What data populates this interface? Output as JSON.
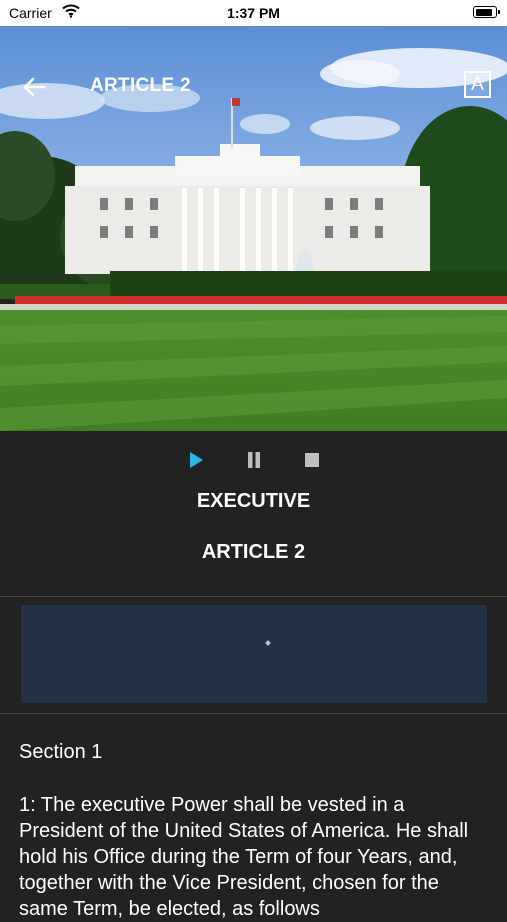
{
  "status_bar": {
    "carrier": "Carrier",
    "time": "1:37 PM",
    "battery_level": 0.92
  },
  "nav": {
    "title": "ARTICLE 2",
    "font_button_label": "A"
  },
  "player": {
    "active_color": "#2bb5e0"
  },
  "headings": {
    "title": "EXECUTIVE",
    "subtitle": "ARTICLE 2"
  },
  "content": {
    "section_title": "Section 1",
    "body": "1: The executive Power shall be vested in a President of the United States of America. He shall hold his Office during the Term of four Years, and, together with the Vice President, chosen for the same Term, be elected, as follows"
  }
}
